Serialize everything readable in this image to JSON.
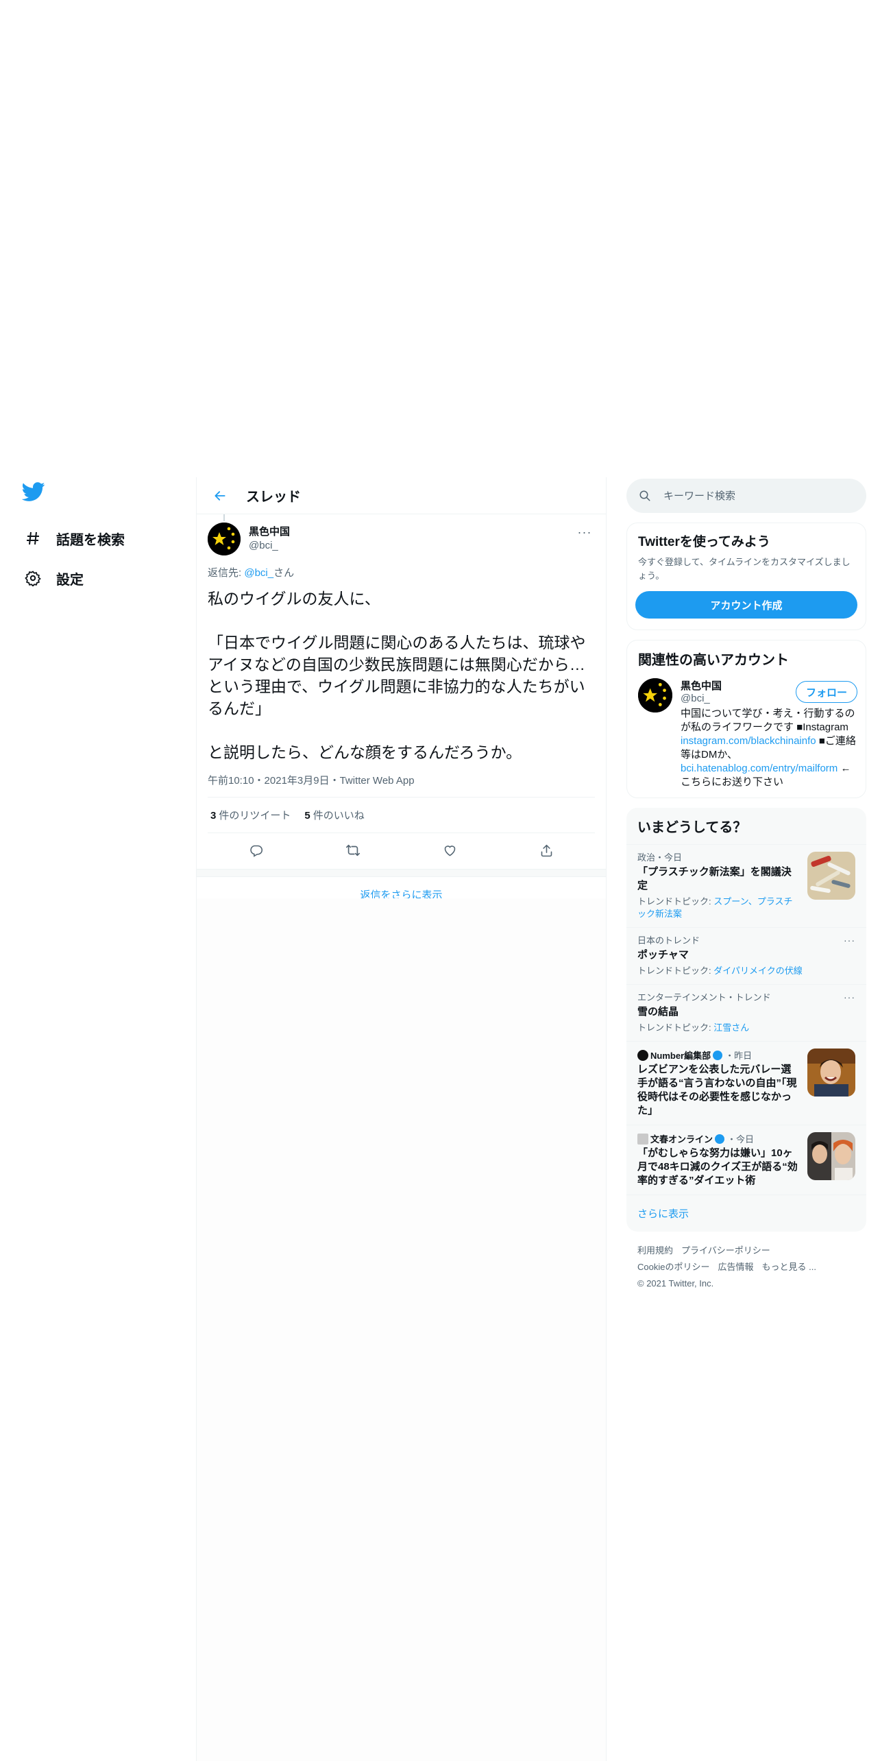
{
  "nav": {
    "explore": "話題を検索",
    "settings": "設定"
  },
  "header": {
    "title": "スレッド"
  },
  "tweet": {
    "author_name": "黒色中国",
    "author_handle": "@bci_",
    "more": "···",
    "reply_prefix": "返信先: ",
    "reply_mention": "@bci_",
    "reply_suffix": "さん",
    "text": "私のウイグルの友人に、\n\n「日本でウイグル問題に関心のある人たちは、琉球やアイヌなどの自国の少数民族問題には無関心だから…という理由で、ウイグル問題に非協力的な人たちがいるんだ」\n\nと説明したら、どんな顔をするんだろうか。",
    "meta": "午前10:10・2021年3月9日・Twitter Web App",
    "retweets_count": "3",
    "retweets_label": "件のリツイート",
    "likes_count": "5",
    "likes_label": "件のいいね"
  },
  "show_more_replies": "返信をさらに表示",
  "sidebar": {
    "search_placeholder": "キーワード検索",
    "signup": {
      "title": "Twitterを使ってみよう",
      "desc": "今すぐ登録して、タイムラインをカスタマイズしましょう。",
      "button": "アカウント作成"
    },
    "relevant": {
      "title": "関連性の高いアカウント",
      "name": "黒色中国",
      "handle": "@bci_",
      "follow": "フォロー",
      "bio_1": "中国について学び・考え・行動するのが私のライフワークです ■Instagram ",
      "bio_link_1": "instagram.com/blackchinainfo",
      "bio_2": " ■ご連絡等はDMか、",
      "bio_link_2": "bci.hatenablog.com/entry/mailform",
      "bio_3": " ←こちらにお送り下さい"
    },
    "trends": {
      "title": "いまどうしてる？",
      "items": [
        {
          "category": "政治・今日",
          "title": "「プラスチック新法案」を閣議決定",
          "topic_prefix": "トレンドトピック: ",
          "topic": "スプーン、プラスチック新法案"
        },
        {
          "category": "日本のトレンド",
          "title": "ポッチャマ",
          "topic_prefix": "トレンドトピック: ",
          "topic": "ダイパリメイクの伏線"
        },
        {
          "category": "エンターテインメント・トレンド",
          "title": "雪の結晶",
          "topic_prefix": "トレンドトピック: ",
          "topic": "江雪さん"
        },
        {
          "source": "Number編集部",
          "time": "・昨日",
          "title": "レズビアンを公表した元バレー選手が語る“言う言わないの自由”「現役時代はその必要性を感じなかった」"
        },
        {
          "source": "文春オンライン",
          "time": "・今日",
          "title": "「がむしゃらな努力は嫌い」10ヶ月で48キロ減のクイズ王が語る“効率的すぎる”ダイエット術"
        }
      ],
      "show_more": "さらに表示"
    },
    "footer": {
      "terms": "利用規約",
      "privacy": "プライバシーポリシー",
      "cookie": "Cookieのポリシー",
      "ads": "広告情報",
      "more": "もっと見る ...",
      "copyright": "© 2021 Twitter, Inc."
    }
  },
  "colors": {
    "accent": "#1d9bf0",
    "text": "#0f1419",
    "secondary": "#536471"
  }
}
